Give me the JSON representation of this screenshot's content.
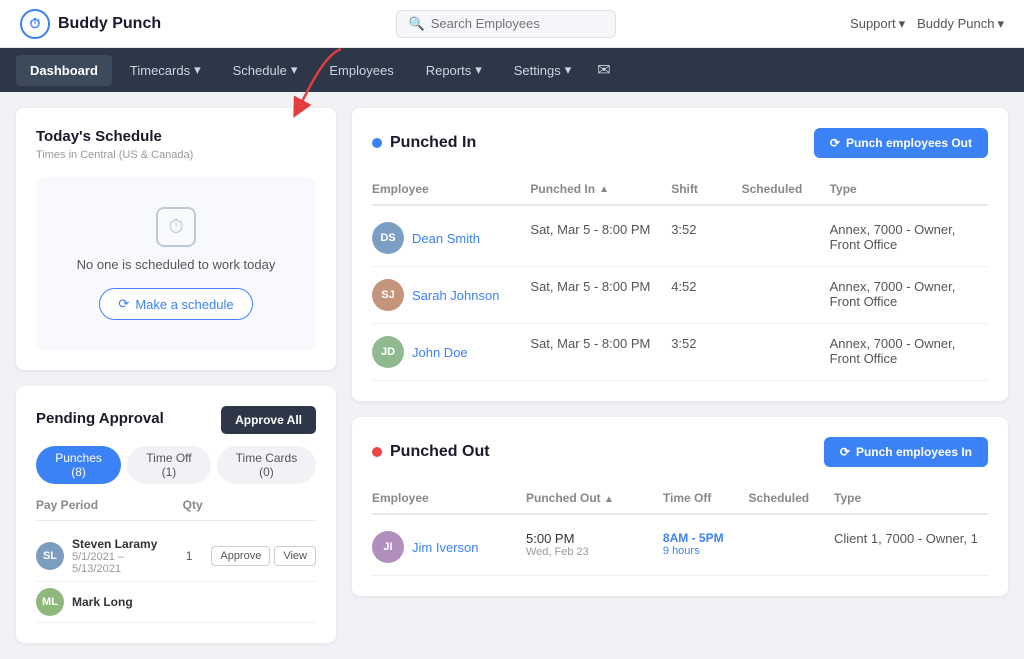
{
  "logo": {
    "icon": "⏱",
    "name": "Buddy Punch"
  },
  "search": {
    "placeholder": "Search Employees"
  },
  "topRight": {
    "support_label": "Support",
    "user_label": "Buddy Punch"
  },
  "nav": {
    "items": [
      {
        "id": "dashboard",
        "label": "Dashboard",
        "active": true
      },
      {
        "id": "timecards",
        "label": "Timecards",
        "has_dropdown": true
      },
      {
        "id": "schedule",
        "label": "Schedule",
        "has_dropdown": true
      },
      {
        "id": "employees",
        "label": "Employees",
        "has_dropdown": false
      },
      {
        "id": "reports",
        "label": "Reports",
        "has_dropdown": true
      },
      {
        "id": "settings",
        "label": "Settings",
        "has_dropdown": true
      }
    ]
  },
  "todaysSchedule": {
    "title": "Today's Schedule",
    "subtitle": "Times in Central (US & Canada)",
    "empty_text": "No one is scheduled to work today",
    "make_schedule_btn": "Make a schedule"
  },
  "pendingApproval": {
    "title": "Pending Approval",
    "approve_all_btn": "Approve All",
    "tabs": [
      {
        "label": "Punches (8)",
        "active": true
      },
      {
        "label": "Time Off (1)",
        "active": false
      },
      {
        "label": "Time Cards (0)",
        "active": false
      }
    ],
    "columns": [
      "Pay Period",
      "Qty"
    ],
    "rows": [
      {
        "initials": "SL",
        "name": "Steven Laramy",
        "date": "5/1/2021 – 5/13/2021",
        "qty": "1",
        "avatar_class": "sl"
      },
      {
        "initials": "ML",
        "name": "Mark Long",
        "date": "",
        "qty": "",
        "avatar_class": "ml"
      }
    ],
    "approve_btn": "Approve",
    "view_btn": "View"
  },
  "punchedIn": {
    "title": "Punched In",
    "punch_out_btn": "Punch employees Out",
    "columns": [
      "Employee",
      "Punched In",
      "Shift",
      "Scheduled",
      "Type"
    ],
    "rows": [
      {
        "name": "Dean Smith",
        "initials": "DS",
        "avatar_class": "ds",
        "punched_in": "Sat, Mar 5 - 8:00 PM",
        "shift": "3:52",
        "scheduled": "",
        "type": "Annex, 7000 - Owner, Front Office"
      },
      {
        "name": "Sarah Johnson",
        "initials": "SJ",
        "avatar_class": "sj",
        "punched_in": "Sat, Mar 5 - 8:00 PM",
        "shift": "4:52",
        "scheduled": "",
        "type": "Annex, 7000 - Owner, Front Office"
      },
      {
        "name": "John Doe",
        "initials": "JD",
        "avatar_class": "jd",
        "punched_in": "Sat, Mar 5 - 8:00 PM",
        "shift": "3:52",
        "scheduled": "",
        "type": "Annex, 7000 - Owner, Front Office"
      }
    ]
  },
  "punchedOut": {
    "title": "Punched Out",
    "punch_in_btn": "Punch employees In",
    "columns": [
      "Employee",
      "Punched Out",
      "Time Off",
      "Scheduled",
      "Type"
    ],
    "rows": [
      {
        "name": "Jim Iverson",
        "initials": "JI",
        "avatar_class": "ji",
        "punched_out": "5:00 PM",
        "punched_out_sub": "Wed, Feb 23",
        "time_off": "8AM - 5PM",
        "time_off_sub": "9 hours",
        "scheduled": "",
        "type": "Client 1, 7000 - Owner, 1"
      }
    ]
  }
}
